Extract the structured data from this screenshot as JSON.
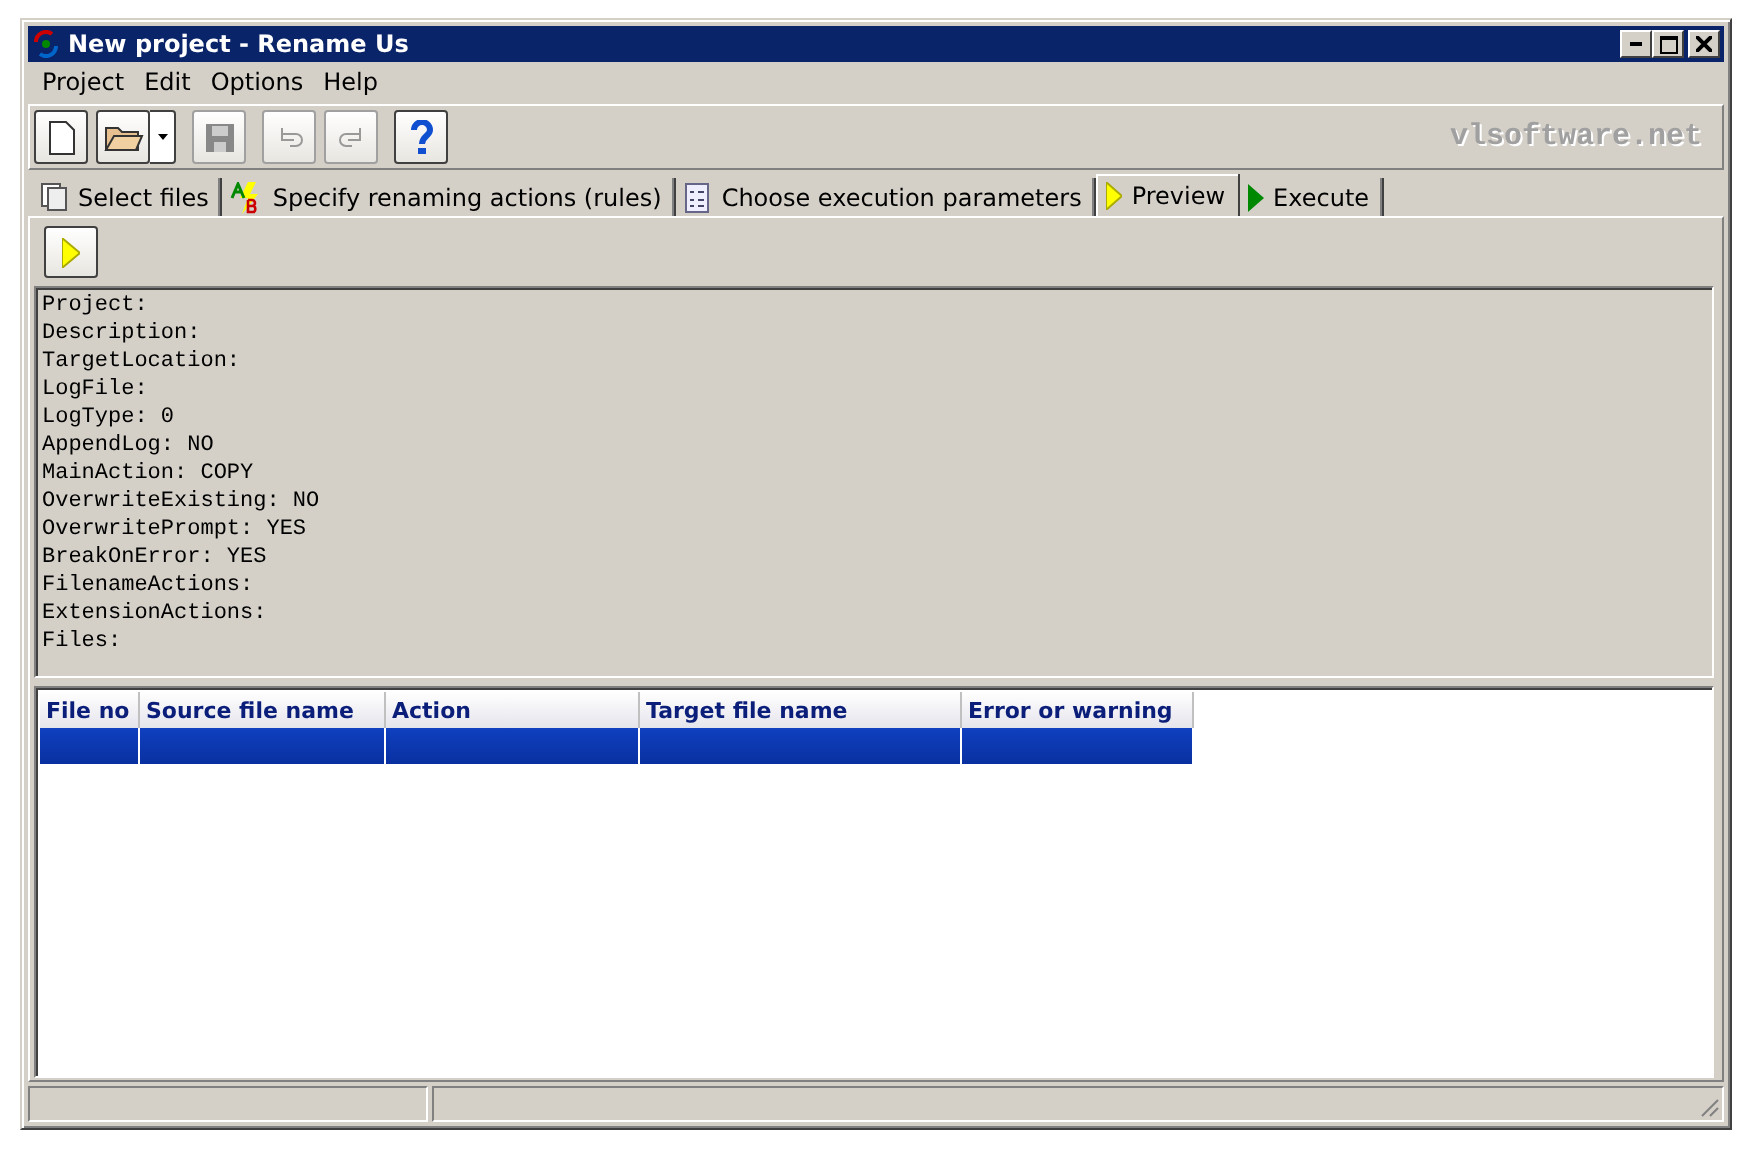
{
  "window": {
    "title": "New project - Rename Us"
  },
  "menu": [
    "Project",
    "Edit",
    "Options",
    "Help"
  ],
  "toolbar": [
    {
      "kind": "new",
      "disabled": false
    },
    {
      "kind": "open",
      "disabled": false
    },
    {
      "kind": "save",
      "disabled": true
    },
    {
      "kind": "undo",
      "disabled": true
    },
    {
      "kind": "redo",
      "disabled": true
    },
    {
      "kind": "help",
      "disabled": false
    }
  ],
  "brand": "vlsoftware.net",
  "tabs": [
    {
      "label": "Select files",
      "kind": "files",
      "selected": false
    },
    {
      "label": "Specify renaming actions (rules)",
      "kind": "rules",
      "selected": false
    },
    {
      "label": "Choose execution parameters",
      "kind": "params",
      "selected": false
    },
    {
      "label": "Preview",
      "kind": "preview",
      "selected": true
    },
    {
      "label": "Execute",
      "kind": "execute",
      "selected": false
    }
  ],
  "log": [
    "Project:",
    "Description:",
    "TargetLocation:",
    "LogFile:",
    "LogType: 0",
    "AppendLog: NO",
    "MainAction: COPY",
    "OverwriteExisting: NO",
    "OverwritePrompt: YES",
    "BreakOnError: YES",
    "FilenameActions:",
    "ExtensionActions:",
    "Files:"
  ],
  "table": {
    "columns": [
      "File no",
      "Source file name",
      "Action",
      "Target file name",
      "Error or warning"
    ],
    "rows": [
      {
        "selected": true
      }
    ]
  }
}
